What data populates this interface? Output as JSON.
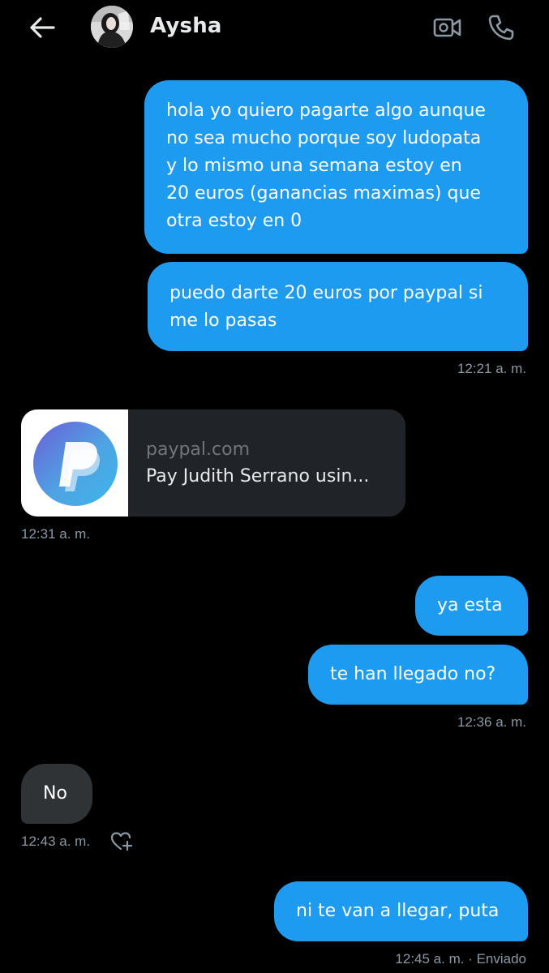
{
  "header": {
    "contact_name": "Aysha",
    "back_icon": "arrow-left-icon",
    "video_icon": "video-camera-icon",
    "call_icon": "phone-icon"
  },
  "messages": [
    {
      "direction": "sent",
      "text": "hola yo quiero pagarte algo aunque\nno sea mucho porque soy ludopata\ny lo mismo una semana estoy en\n20 euros (ganancias maximas) que\notra estoy en 0"
    },
    {
      "direction": "sent",
      "text": "puedo darte 20 euros por paypal si\nme lo pasas"
    },
    {
      "direction": "received",
      "type": "link",
      "domain": "paypal.com",
      "title": "Pay Judith Serrano usin..."
    },
    {
      "direction": "sent",
      "text": "ya esta"
    },
    {
      "direction": "sent",
      "text": "te han llegado no?"
    },
    {
      "direction": "received",
      "text": "No"
    },
    {
      "direction": "sent",
      "text": "ni te van a llegar, puta"
    }
  ],
  "timestamps": {
    "t1": "12:21 a. m.",
    "t2": "12:31 a. m.",
    "t3": "12:36 a. m.",
    "t4": "12:43 a. m.",
    "t5": "12:45 a. m. · Enviado"
  },
  "colors": {
    "background": "#000000",
    "sent_bubble": "#1d9bf0",
    "received_bubble": "#2f3336",
    "timestamp": "#8b98a5"
  }
}
